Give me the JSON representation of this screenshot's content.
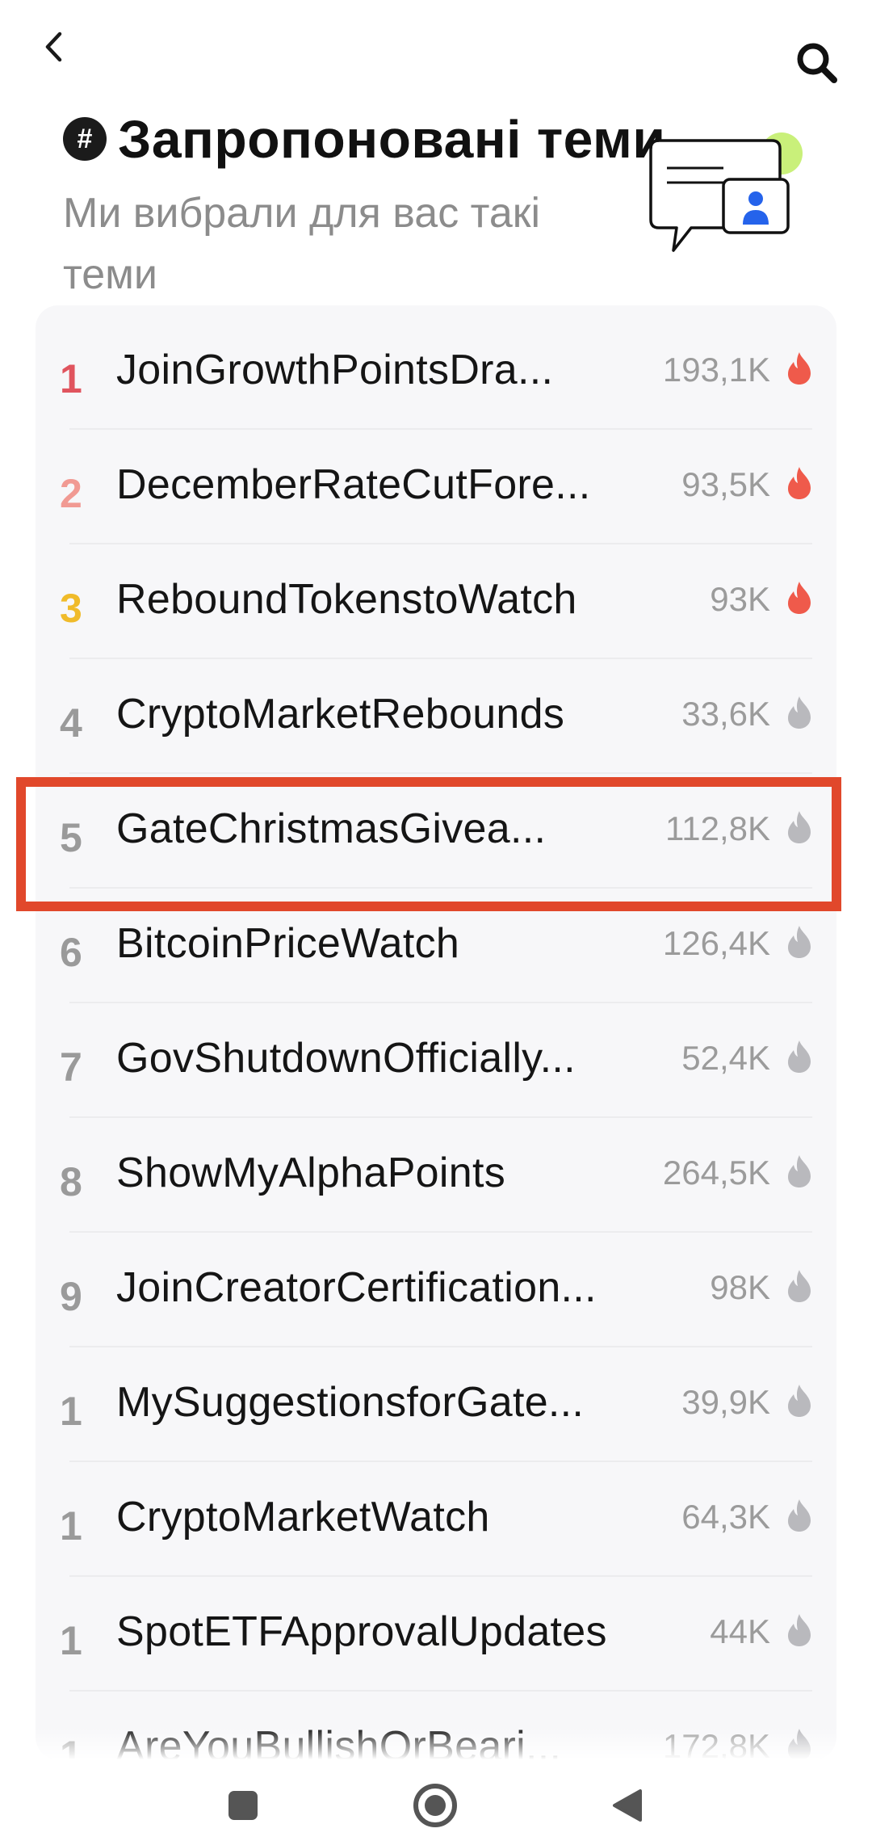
{
  "header": {
    "title": "Запропоновані теми",
    "subtitle": "Ми вибрали для вас такі теми"
  },
  "topics": [
    {
      "rank": "1",
      "name": "JoinGrowthPointsDra...",
      "count": "193,1K",
      "hot": true
    },
    {
      "rank": "2",
      "name": "DecemberRateCutFore...",
      "count": "93,5K",
      "hot": true
    },
    {
      "rank": "3",
      "name": "ReboundTokenstoWatch",
      "count": "93K",
      "hot": true
    },
    {
      "rank": "4",
      "name": "CryptoMarketRebounds",
      "count": "33,6K",
      "hot": false
    },
    {
      "rank": "5",
      "name": "GateChristmasGivea...",
      "count": "112,8K",
      "hot": false
    },
    {
      "rank": "6",
      "name": "BitcoinPriceWatch",
      "count": "126,4K",
      "hot": false
    },
    {
      "rank": "7",
      "name": "GovShutdownOfficially...",
      "count": "52,4K",
      "hot": false
    },
    {
      "rank": "8",
      "name": "ShowMyAlphaPoints",
      "count": "264,5K",
      "hot": false
    },
    {
      "rank": "9",
      "name": "JoinCreatorCertification...",
      "count": "98K",
      "hot": false
    },
    {
      "rank": "1",
      "name": "MySuggestionsforGate...",
      "count": "39,9K",
      "hot": false
    },
    {
      "rank": "1",
      "name": "CryptoMarketWatch",
      "count": "64,3K",
      "hot": false
    },
    {
      "rank": "1",
      "name": "SpotETFApprovalUpdates",
      "count": "44K",
      "hot": false
    },
    {
      "rank": "1",
      "name": "AreYouBullishOrBeari...",
      "count": "172,8K",
      "hot": false
    }
  ],
  "colors": {
    "rank1": "#e0545e",
    "rank2": "#f19a93",
    "rank3": "#f0bb2a",
    "hot_flame": "#ef5a4b",
    "flame": "#b9b9bd",
    "highlight": "#e1482b",
    "accent_blue": "#2563eb",
    "accent_green": "#c9f07a"
  },
  "icons": {
    "back": "chevron-left-icon",
    "search": "search-icon",
    "hash": "hashtag-icon",
    "flame": "flame-icon",
    "illustration": "chat-bubble-user-icon",
    "nav_recents": "square-icon",
    "nav_home": "circle-icon",
    "nav_back": "triangle-back-icon"
  }
}
